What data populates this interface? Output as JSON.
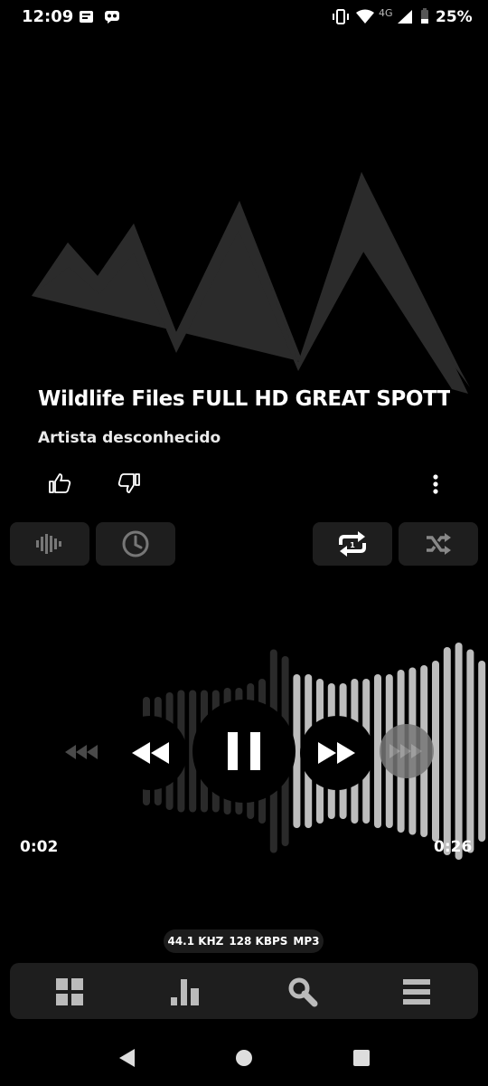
{
  "status_bar": {
    "time": "12:09",
    "network_label": "4G",
    "battery": "25%",
    "icons": [
      "notification-news-icon",
      "notification-chat-icon",
      "vibrate-icon",
      "wifi-icon",
      "signal-icon",
      "battery-icon"
    ]
  },
  "track": {
    "title": "Wildlife Files FULL HD GREAT SPOTTE",
    "artist": "Artista desconhecido"
  },
  "actions": {
    "icons": [
      "thumbs-up-icon",
      "thumbs-down-icon",
      "more-vertical-icon"
    ]
  },
  "mode_buttons": {
    "icons": [
      "visualizer-icon",
      "sleep-timer-icon",
      "repeat-one-icon",
      "shuffle-icon"
    ],
    "repeat_badge": "1"
  },
  "playback": {
    "elapsed": "0:02",
    "duration": "0:26",
    "progress_fraction": 0.077,
    "state": "playing"
  },
  "format": {
    "sample_rate": "44.1 KHZ",
    "bitrate": "128 KBPS",
    "codec": "MP3"
  },
  "bottom_nav": {
    "icons": [
      "library-grid-icon",
      "charts-icon",
      "search-icon",
      "menu-icon"
    ]
  },
  "system_nav": {
    "icons": [
      "back-icon",
      "home-icon",
      "recents-icon"
    ]
  },
  "colors": {
    "background": "#000000",
    "panel": "#1e1e1e",
    "wave_played": "#2a2a2a",
    "wave_unplayed": "#bdbdbd",
    "art": "#2b2b2b"
  }
}
